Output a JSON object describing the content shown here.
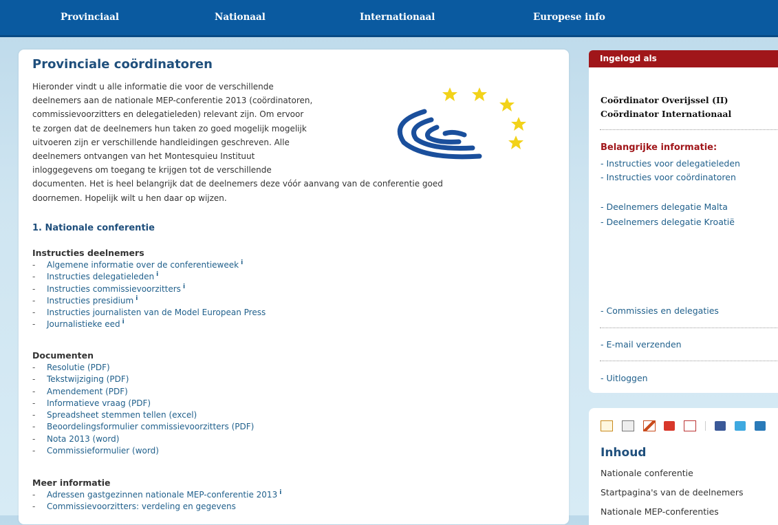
{
  "nav": {
    "items": [
      "Provinciaal",
      "Nationaal",
      "Internationaal",
      "Europese info"
    ]
  },
  "main": {
    "title": "Provinciale coördinatoren",
    "intro_narrow": [
      "Hieronder vindt u alle informatie die voor de verschillende",
      "deelnemers aan de nationale MEP-conferentie 2013 (coördinatoren,",
      "commissievoorzitters en delegatieleden) relevant zijn. Om ervoor",
      "te zorgen dat de deelnemers hun taken zo goed mogelijk mogelijk",
      "uitvoeren zijn er verschillende handleidingen geschreven. Alle",
      "deelnemers ontvangen van het Montesquieu Instituut",
      "inloggegevens om toegang te krijgen tot de verschillende"
    ],
    "intro_wide": [
      "documenten. Het is heel belangrijk dat de deelnemers deze vóór aanvang van de conferentie goed",
      "doornemen. Hopelijk wilt u hen daar op wijzen."
    ],
    "section1_title": "1. Nationale conferentie",
    "groups": [
      {
        "title": "Instructies deelnemers",
        "items": [
          {
            "label": "Algemene informatie over de conferentieweek",
            "info": "i"
          },
          {
            "label": "Instructies delegatieleden",
            "info": "i"
          },
          {
            "label": "Instructies commissievoorzitters",
            "info": "i"
          },
          {
            "label": "Instructies presidium",
            "info": "i"
          },
          {
            "label": "Instructies journalisten van de Model European Press",
            "info": ""
          },
          {
            "label": "Journalistieke eed",
            "info": "i"
          }
        ]
      },
      {
        "title": "Documenten",
        "items": [
          {
            "label": "Resolutie (PDF)",
            "info": ""
          },
          {
            "label": "Tekstwijziging (PDF)",
            "info": ""
          },
          {
            "label": "Amendement (PDF)",
            "info": ""
          },
          {
            "label": "Informatieve vraag (PDF)",
            "info": ""
          },
          {
            "label": "Spreadsheet stemmen tellen (excel)",
            "info": ""
          },
          {
            "label": "Beoordelingsformulier commissievoorzitters (PDF)",
            "info": ""
          },
          {
            "label": "Nota 2013 (word)",
            "info": ""
          },
          {
            "label": "Commissieformulier (word)",
            "info": ""
          }
        ]
      },
      {
        "title": "Meer informatie",
        "items": [
          {
            "label": "Adressen gastgezinnen nationale MEP-conferentie 2013",
            "info": "i"
          },
          {
            "label": "Commissievoorzitters: verdeling en gegevens",
            "info": ""
          }
        ]
      }
    ]
  },
  "sidebar": {
    "logged_in_label": "Ingelogd als",
    "user_lines": [
      "Coördinator Overijssel (II)",
      "Coördinator Internationaal"
    ],
    "important_title": "Belangrijke informatie:",
    "important_links": [
      "- Instructies voor delegatieleden",
      "- Instructies voor coördinatoren",
      "- Deelnemers delegatie Malta",
      "- Deelnemers delegatie Kroatië"
    ],
    "commissies_link": "- Commissies en delegaties",
    "email_link": "- E-mail verzenden",
    "logout_link": "- Uitloggen"
  },
  "sidebar2": {
    "icons": [
      "mail-icon",
      "print-icon",
      "home-icon",
      "share-icon",
      "pdf-icon",
      "facebook-icon",
      "twitter-icon",
      "linkedin-icon"
    ],
    "inhoud_title": "Inhoud",
    "links": [
      "Nationale conferentie",
      "Startpagina's van de deelnemers",
      "Nationale MEP-conferenties"
    ]
  },
  "colors": {
    "nav_bg": "#0a5aa0",
    "accent_red": "#a0161a",
    "link_blue": "#1f5f8b",
    "heading_blue": "#1f4f7c"
  }
}
